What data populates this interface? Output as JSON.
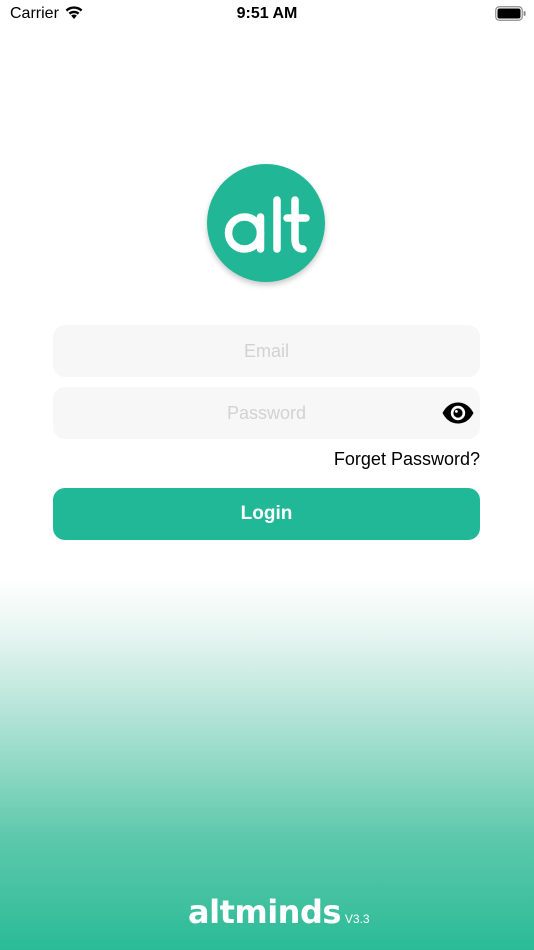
{
  "status_bar": {
    "carrier": "Carrier",
    "time": "9:51 AM",
    "wifi_icon": "wifi-icon",
    "battery_icon": "battery-full-icon"
  },
  "logo": {
    "text": "alt",
    "color": "#21b796"
  },
  "login_form": {
    "email_placeholder": "Email",
    "email_value": "",
    "password_placeholder": "Password",
    "password_value": "",
    "visibility_icon": "eye-icon",
    "forget_password": "Forget Password?",
    "login_label": "Login"
  },
  "footer": {
    "brand": "altminds",
    "version": "V3.3"
  },
  "colors": {
    "accent": "#21b898",
    "gradient_bottom": "#2bbb97",
    "field_background": "#f7f7f7"
  }
}
